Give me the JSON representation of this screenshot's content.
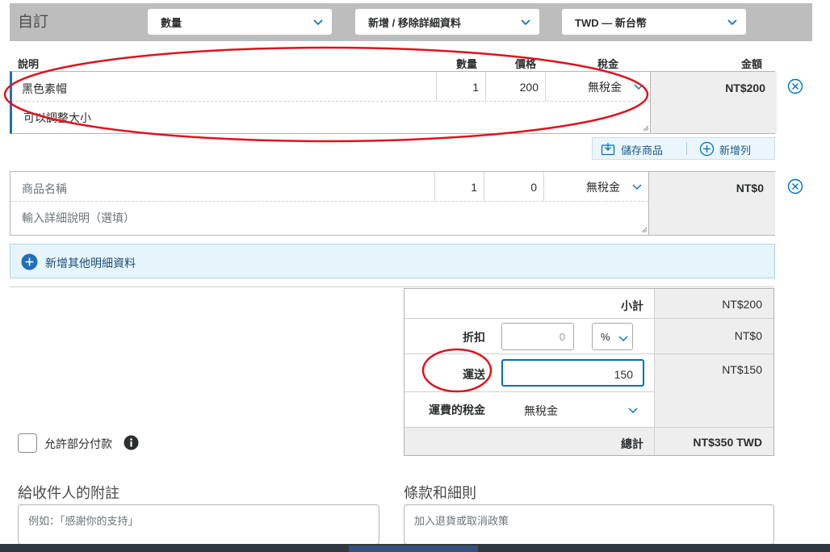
{
  "toolbar": {
    "label": "自訂",
    "quantity_select": "數量",
    "details_select": "新增 / 移除詳細資料",
    "currency_select": "TWD — 新台幣"
  },
  "columns": {
    "description": "說明",
    "quantity": "數量",
    "price": "價格",
    "tax": "稅金",
    "amount": "金額"
  },
  "items": [
    {
      "name": "黑色素帽",
      "quantity": "1",
      "price": "200",
      "tax": "無稅金",
      "description": "可以調整大小",
      "amount": "NT$200"
    },
    {
      "name_placeholder": "商品名稱",
      "quantity": "1",
      "price": "0",
      "tax": "無稅金",
      "description_placeholder": "輸入詳細說明（選填）",
      "amount": "NT$0"
    }
  ],
  "item_actions": {
    "save_item": "儲存商品",
    "add_row": "新增列"
  },
  "add_more": "新增其他明細資料",
  "totals": {
    "subtotal_label": "小計",
    "subtotal_value": "NT$200",
    "discount_label": "折扣",
    "discount_input": "0",
    "discount_unit": "%",
    "discount_value": "NT$0",
    "shipping_label": "運送",
    "shipping_input": "150",
    "shipping_value": "NT$150",
    "shipping_tax_label": "運費的稅金",
    "shipping_tax_value": "無稅金",
    "total_label": "總計",
    "total_value": "NT$350 TWD"
  },
  "partial_payment_label": "允許部分付款",
  "note": {
    "title": "給收件人的附註",
    "placeholder": "例如：「感謝你的支持」"
  },
  "terms": {
    "title": "條款和細則",
    "placeholder": "加入退貨或取消政策"
  },
  "colors": {
    "annotation_red": "#e0121b",
    "link_blue": "#0070ba",
    "item_accent": "#1f6fb8"
  }
}
